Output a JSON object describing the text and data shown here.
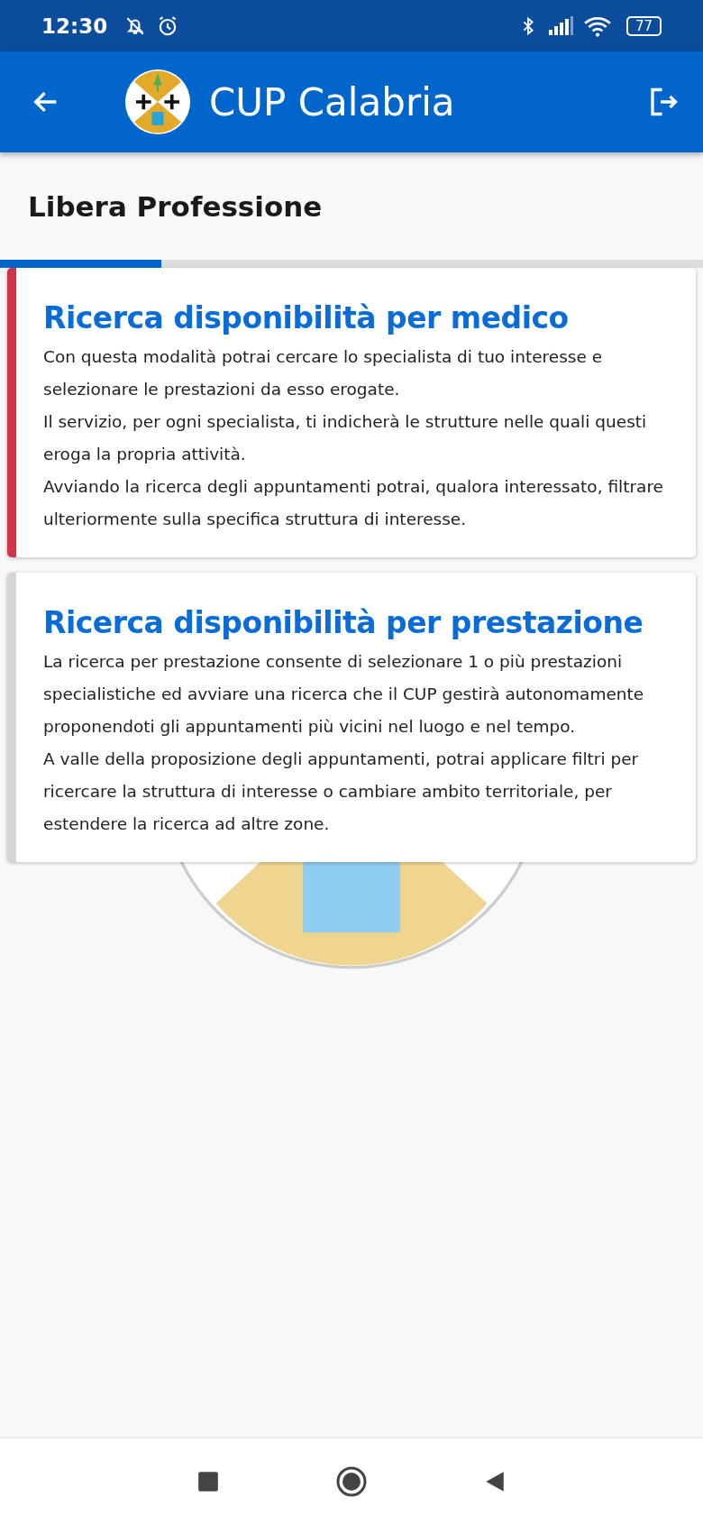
{
  "status_bar": {
    "time": "12:30",
    "battery": "77"
  },
  "app_bar": {
    "title": "CUP Calabria"
  },
  "page": {
    "title": "Libera Professione",
    "progress": {
      "level": 0.23
    }
  },
  "cards": [
    {
      "title": "Ricerca disponibilità per medico",
      "selected": true,
      "paragraphs": [
        "Con questa modalità potrai cercare lo specialista di tuo interesse e selezionare le prestazioni da esso erogate.",
        "Il servizio, per ogni specialista, ti indicherà le strutture nelle quali questi eroga la propria attività.",
        "Avviando la ricerca degli appuntamenti potrai, qualora interessato, filtrare ulteriormente sulla specifica struttura di interesse."
      ]
    },
    {
      "title": "Ricerca disponibilità per prestazione",
      "selected": false,
      "paragraphs": [
        "La ricerca per prestazione consente di selezionare 1 o più prestazioni specialistiche ed avviare una ricerca che il CUP gestirà autonomamente proponendoti gli appuntamenti più vicini nel luogo e nel tempo.",
        "A valle della proposizione degli appuntamenti, potrai applicare filtri per ricercare la struttura di interesse o cambiare ambito territoriale, per estendere la ricerca ad altre zone."
      ]
    }
  ]
}
